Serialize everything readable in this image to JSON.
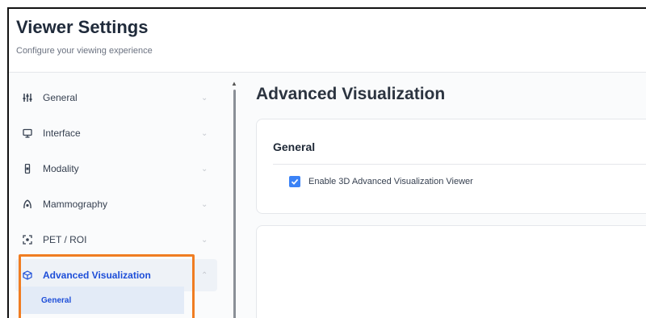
{
  "header": {
    "title": "Viewer Settings",
    "subtitle": "Configure your viewing experience"
  },
  "sidebar": {
    "items": [
      {
        "label": "General",
        "icon": "sliders-icon",
        "expanded": false
      },
      {
        "label": "Interface",
        "icon": "monitor-icon",
        "expanded": false
      },
      {
        "label": "Modality",
        "icon": "device-icon",
        "expanded": false
      },
      {
        "label": "Mammography",
        "icon": "mammography-icon",
        "expanded": false
      },
      {
        "label": "PET / ROI",
        "icon": "scan-icon",
        "expanded": false
      },
      {
        "label": "Advanced Visualization",
        "icon": "cube-icon",
        "expanded": true,
        "active": true
      }
    ],
    "subitems": [
      {
        "label": "General",
        "active": true
      }
    ]
  },
  "main": {
    "title": "Advanced Visualization",
    "section": {
      "title": "General",
      "checkbox_label": "Enable 3D Advanced Visualization Viewer",
      "checked": true
    }
  },
  "colors": {
    "accent": "#1d4ed8",
    "checkbox": "#3b82f6",
    "highlight": "#f07d22"
  }
}
